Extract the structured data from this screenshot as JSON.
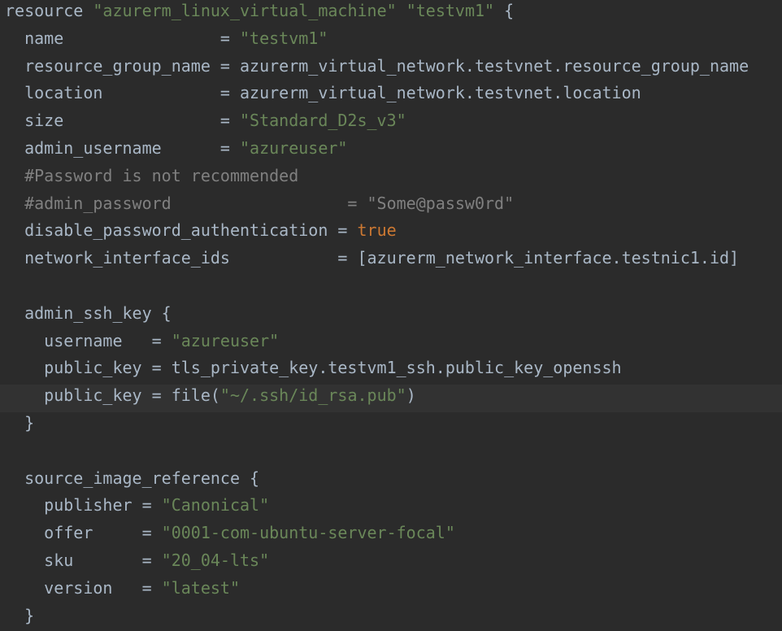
{
  "editor": {
    "colors": {
      "background": "#2b2b2b",
      "current_line": "#323232",
      "plain": "#a9b7c6",
      "string": "#6a8759",
      "comment": "#808080",
      "boolean": "#cc7832"
    },
    "current_line_index": 14,
    "lines": [
      [
        {
          "t": "plain",
          "v": "resource "
        },
        {
          "t": "string",
          "v": "\"azurerm_linux_virtual_machine\""
        },
        {
          "t": "plain",
          "v": " "
        },
        {
          "t": "string",
          "v": "\"testvm1\""
        },
        {
          "t": "plain",
          "v": " {"
        }
      ],
      [
        {
          "t": "plain",
          "v": "  name                "
        },
        {
          "t": "plain",
          "v": "= "
        },
        {
          "t": "string",
          "v": "\"testvm1\""
        }
      ],
      [
        {
          "t": "plain",
          "v": "  resource_group_name = azurerm_virtual_network.testvnet.resource_group_name"
        }
      ],
      [
        {
          "t": "plain",
          "v": "  location            = azurerm_virtual_network.testvnet.location"
        }
      ],
      [
        {
          "t": "plain",
          "v": "  size                = "
        },
        {
          "t": "string",
          "v": "\"Standard_D2s_v3\""
        }
      ],
      [
        {
          "t": "plain",
          "v": "  admin_username      = "
        },
        {
          "t": "string",
          "v": "\"azureuser\""
        }
      ],
      [
        {
          "t": "comment",
          "v": "  #Password is not recommended"
        }
      ],
      [
        {
          "t": "comment",
          "v": "  #admin_password                  = \"Some@passw0rd\""
        }
      ],
      [
        {
          "t": "plain",
          "v": "  disable_password_authentication = "
        },
        {
          "t": "bool",
          "v": "true"
        }
      ],
      [
        {
          "t": "plain",
          "v": "  network_interface_ids           = [azurerm_network_interface.testnic1.id]"
        }
      ],
      [],
      [
        {
          "t": "plain",
          "v": "  admin_ssh_key {"
        }
      ],
      [
        {
          "t": "plain",
          "v": "    username   = "
        },
        {
          "t": "string",
          "v": "\"azureuser\""
        }
      ],
      [
        {
          "t": "plain",
          "v": "    public_key = tls_private_key.testvm1_ssh.public_key_openssh"
        }
      ],
      [
        {
          "t": "plain",
          "v": "    public_key = file("
        },
        {
          "t": "string",
          "v": "\"~/.ssh/id_rsa.pub\""
        },
        {
          "t": "plain",
          "v": ")"
        }
      ],
      [
        {
          "t": "plain",
          "v": "  }"
        }
      ],
      [],
      [
        {
          "t": "plain",
          "v": "  source_image_reference {"
        }
      ],
      [
        {
          "t": "plain",
          "v": "    publisher = "
        },
        {
          "t": "string",
          "v": "\"Canonical\""
        }
      ],
      [
        {
          "t": "plain",
          "v": "    offer     = "
        },
        {
          "t": "string",
          "v": "\"0001-com-ubuntu-server-focal\""
        }
      ],
      [
        {
          "t": "plain",
          "v": "    sku       = "
        },
        {
          "t": "string",
          "v": "\"20_04-lts\""
        }
      ],
      [
        {
          "t": "plain",
          "v": "    version   = "
        },
        {
          "t": "string",
          "v": "\"latest\""
        }
      ],
      [
        {
          "t": "plain",
          "v": "  }"
        }
      ]
    ]
  }
}
